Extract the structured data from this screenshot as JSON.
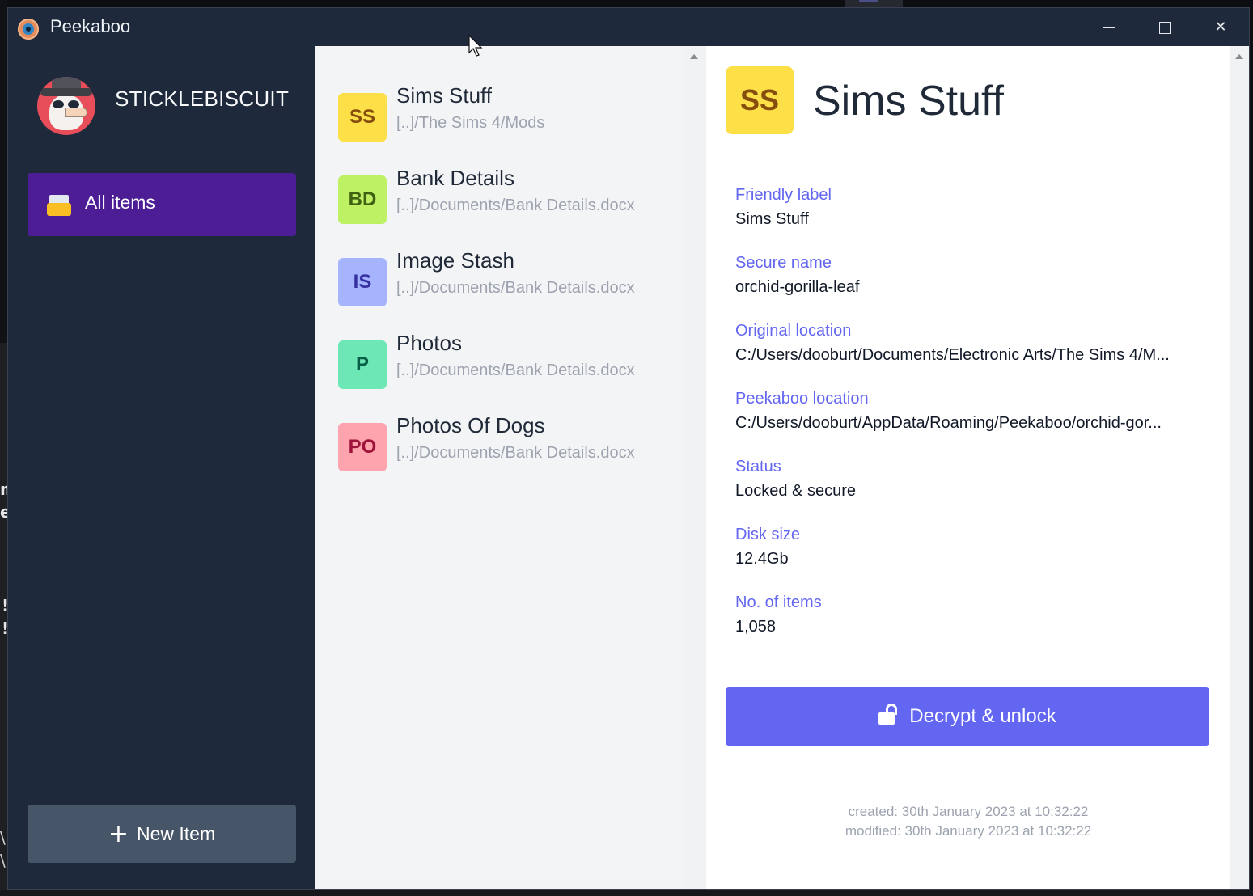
{
  "window": {
    "app_title": "Peekaboo",
    "controls": {
      "minimize": "minimize-icon",
      "maximize": "maximize-icon",
      "close": "✕"
    }
  },
  "sidebar": {
    "username": "STICKLEBISCUIT",
    "nav": [
      {
        "label": "All items",
        "icon": "inbox-tray-icon",
        "active": true
      }
    ],
    "new_item": {
      "plus": "+",
      "label": "New Item"
    }
  },
  "list": {
    "items": [
      {
        "initials": "SS",
        "title": "Sims Stuff",
        "path": "[..]/The Sims 4/Mods",
        "bg": "#fde047",
        "fg": "#854d0e",
        "selected": true
      },
      {
        "initials": "BD",
        "title": "Bank Details",
        "path": "[..]/Documents/Bank Details.docx",
        "bg": "#bef264",
        "fg": "#3f6212"
      },
      {
        "initials": "IS",
        "title": "Image Stash",
        "path": "[..]/Documents/Bank Details.docx",
        "bg": "#a5b4fc",
        "fg": "#3730a3"
      },
      {
        "initials": "P",
        "title": "Photos",
        "path": "[..]/Documents/Bank Details.docx",
        "bg": "#6ee7b7",
        "fg": "#065f46"
      },
      {
        "initials": "PO",
        "title": "Photos Of Dogs",
        "path": "[..]/Documents/Bank Details.docx",
        "bg": "#fda4af",
        "fg": "#9f1239"
      }
    ]
  },
  "detail": {
    "initials": "SS",
    "title": "Sims Stuff",
    "fields": [
      {
        "label": "Friendly label",
        "value": "Sims Stuff"
      },
      {
        "label": "Secure name",
        "value": "orchid-gorilla-leaf"
      },
      {
        "label": "Original location",
        "value": "C:/Users/dooburt/Documents/Electronic Arts/The Sims 4/M..."
      },
      {
        "label": "Peekaboo location",
        "value": "C:/Users/dooburt/AppData/Roaming/Peekaboo/orchid-gor..."
      },
      {
        "label": "Status",
        "value": "Locked & secure"
      },
      {
        "label": "Disk size",
        "value": "12.4Gb"
      },
      {
        "label": "No. of items",
        "value": "1,058"
      }
    ],
    "unlock_button": "Decrypt & unlock",
    "created": "created: 30th January 2023 at 10:32:22",
    "modified": "modified: 30th January 2023 at 10:32:22"
  },
  "background": {
    "fragment_m": "m",
    "fragment_e": "e",
    "fragment_bang1": "!",
    "fragment_bang2": "!",
    "fragment_slash1": "\\",
    "fragment_slash2": "\\"
  },
  "colors": {
    "sidebar_bg": "#1e293b",
    "nav_active": "#4c1d95",
    "new_item_btn": "#475569",
    "accent": "#6366f1",
    "list_bg": "#f3f4f6"
  }
}
